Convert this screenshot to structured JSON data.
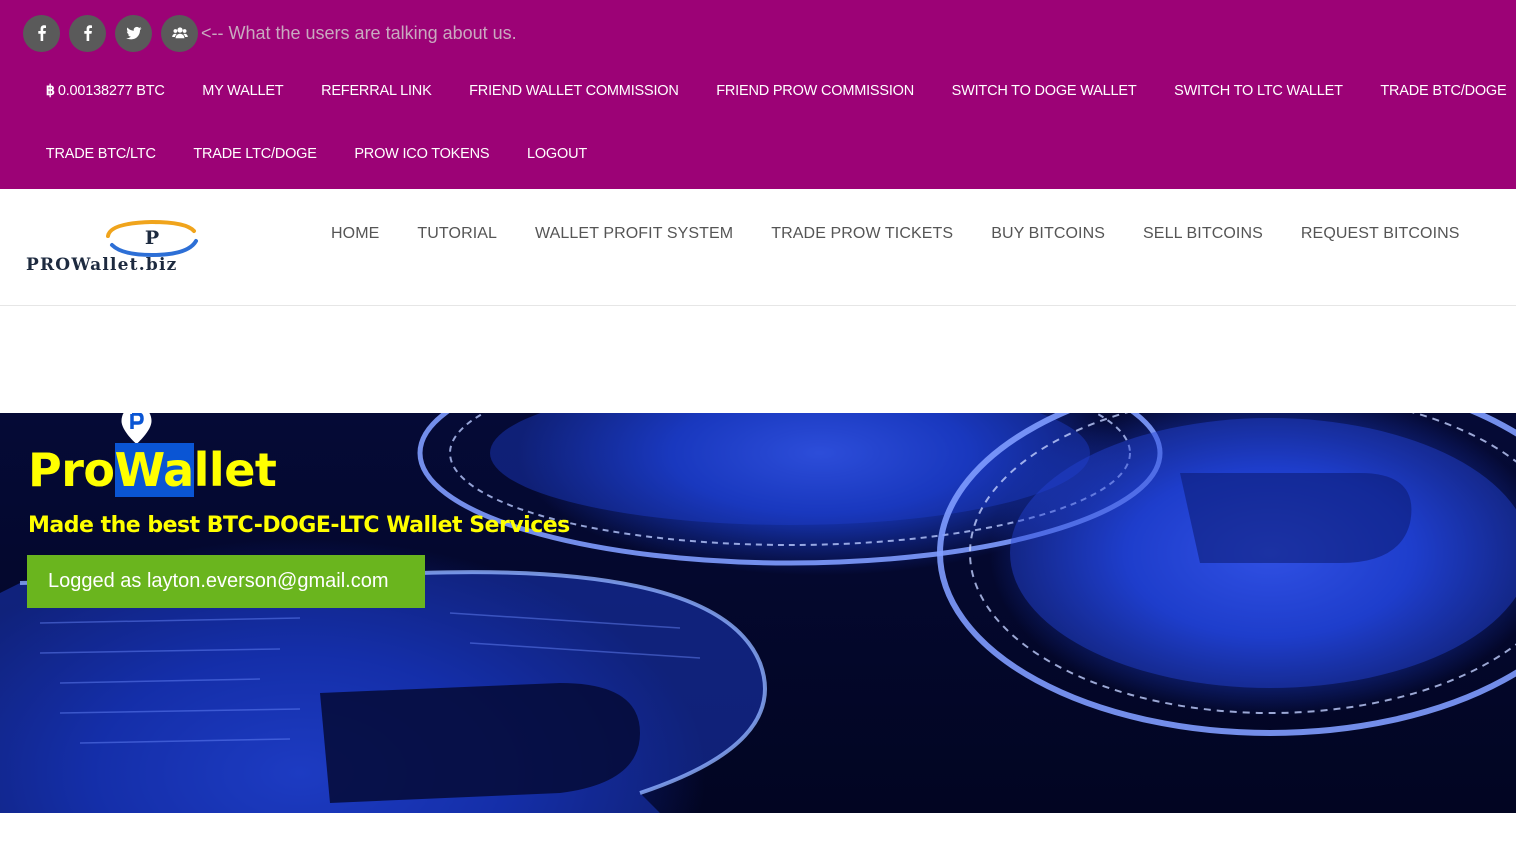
{
  "social": {
    "buttons": [
      {
        "name": "facebook",
        "icon": "facebook-icon"
      },
      {
        "name": "facebook",
        "icon": "facebook-icon"
      },
      {
        "name": "twitter",
        "icon": "twitter-icon"
      },
      {
        "name": "users",
        "icon": "users-icon"
      }
    ],
    "note": "<-- What the users are talking about us."
  },
  "top_menu": {
    "balance_glyph": "฿",
    "balance_text": "0.00138277 BTC",
    "row1": [
      "MY WALLET",
      "REFERRAL LINK",
      "FRIEND WALLET COMMISSION",
      "FRIEND PROW COMMISSION",
      "SWITCH TO DOGE WALLET",
      "SWITCH TO LTC WALLET",
      "TRADE BTC/DOGE"
    ],
    "row2": [
      "TRADE BTC/LTC",
      "TRADE LTC/DOGE",
      "PROW ICO TOKENS",
      "LOGOUT"
    ]
  },
  "logo": {
    "letter": "P",
    "text": "PROWallet.biz"
  },
  "nav": [
    "HOME",
    "TUTORIAL",
    "WALLET PROFIT SYSTEM",
    "TRADE PROW TICKETS",
    "BUY BITCOINS",
    "SELL BITCOINS",
    "REQUEST BITCOINS"
  ],
  "hero": {
    "title_part1": "Pro",
    "title_highlight": "Wa",
    "title_part2": "llet",
    "subtitle": "Made the best BTC-DOGE-LTC Wallet Services",
    "logged_label": "Logged as layton.everson@gmail.com"
  },
  "colors": {
    "topbar": "#9c0276",
    "title_yellow": "#ffff00",
    "logged_green": "#6ab51e",
    "highlight_blue": "#0a55d4"
  }
}
